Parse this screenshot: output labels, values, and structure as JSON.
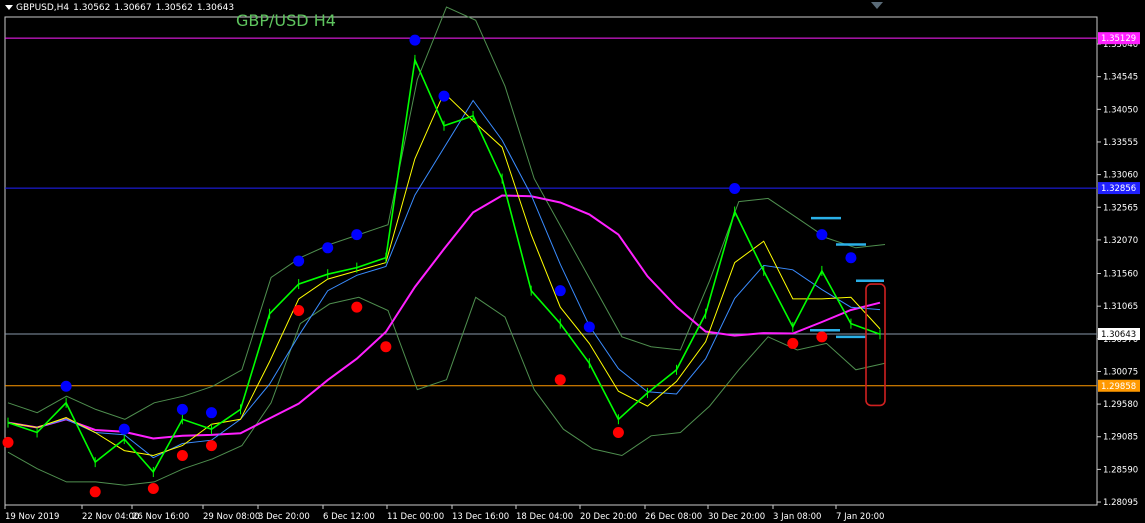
{
  "header": {
    "symbol": "GBPUSD,H4",
    "open": "1.30562",
    "high": "1.30667",
    "low": "1.30562",
    "close": "1.30643"
  },
  "title": "GBP/USD H4",
  "colors": {
    "background": "#000000",
    "candle": "#00ff00",
    "bollinger": "#4f8f4f",
    "ma_fast": "#ffff00",
    "ma_mid": "#3a8cff",
    "ma_slow": "#ff20ff",
    "fractal_up": "#0000ff",
    "fractal_down": "#ff0000",
    "marks": "#2ab0e8",
    "box": "#d02020",
    "axis_text": "#ffffff"
  },
  "chart_data": {
    "type": "line",
    "title": "GBP/USD H4",
    "y_range": [
      1.2805,
      1.3545
    ],
    "y_ticks": [
      "1.35040",
      "1.34545",
      "1.34050",
      "1.33555",
      "1.33060",
      "1.32565",
      "1.32070",
      "1.31560",
      "1.31065",
      "1.30570",
      "1.30075",
      "1.29580",
      "1.29085",
      "1.28590",
      "1.28095"
    ],
    "x_ticks": [
      "19 Nov 2019",
      "22 Nov 04:00",
      "26 Nov 16:00",
      "29 Nov 08:00",
      "3 Dec 20:00",
      "6 Dec 12:00",
      "11 Dec 00:00",
      "13 Dec 16:00",
      "18 Dec 04:00",
      "20 Dec 20:00",
      "26 Dec 08:00",
      "30 Dec 20:00",
      "3 Jan 08:00",
      "7 Jan 20:00"
    ],
    "horizontal_levels": [
      {
        "price": 1.35129,
        "label": "1.35129",
        "color": "#ff20ff"
      },
      {
        "price": 1.32856,
        "label": "1.32856",
        "color": "#2020ff"
      },
      {
        "price": 1.30643,
        "label": "1.30643",
        "color": "#8899aa"
      },
      {
        "price": 1.29858,
        "label": "1.29858",
        "color": "#ff9900"
      }
    ],
    "price_path": [
      {
        "x": "19 Nov 2019",
        "y": 1.293
      },
      {
        "x": "20 Nov",
        "y": 1.2915
      },
      {
        "x": "21 Nov",
        "y": 1.296
      },
      {
        "x": "22 Nov 04:00",
        "y": 1.287
      },
      {
        "x": "25 Nov",
        "y": 1.2905
      },
      {
        "x": "26 Nov 16:00",
        "y": 1.2855
      },
      {
        "x": "27 Nov",
        "y": 1.2935
      },
      {
        "x": "29 Nov 08:00",
        "y": 1.292
      },
      {
        "x": "2 Dec",
        "y": 1.295
      },
      {
        "x": "3 Dec 20:00",
        "y": 1.3095
      },
      {
        "x": "5 Dec",
        "y": 1.314
      },
      {
        "x": "6 Dec 12:00",
        "y": 1.3155
      },
      {
        "x": "9 Dec",
        "y": 1.3165
      },
      {
        "x": "10 Dec",
        "y": 1.318
      },
      {
        "x": "11 Dec 00:00",
        "y": 1.348
      },
      {
        "x": "12 Dec",
        "y": 1.338
      },
      {
        "x": "13 Dec 16:00",
        "y": 1.3395
      },
      {
        "x": "16 Dec",
        "y": 1.33
      },
      {
        "x": "17 Dec",
        "y": 1.313
      },
      {
        "x": "18 Dec 04:00",
        "y": 1.308
      },
      {
        "x": "19 Dec",
        "y": 1.302
      },
      {
        "x": "20 Dec 20:00",
        "y": 1.2935
      },
      {
        "x": "23 Dec",
        "y": 1.2975
      },
      {
        "x": "26 Dec 08:00",
        "y": 1.301
      },
      {
        "x": "27 Dec",
        "y": 1.3095
      },
      {
        "x": "30 Dec 20:00",
        "y": 1.325
      },
      {
        "x": "1 Jan",
        "y": 1.316
      },
      {
        "x": "3 Jan 08:00",
        "y": 1.3075
      },
      {
        "x": "6 Jan",
        "y": 1.316
      },
      {
        "x": "7 Jan 20:00",
        "y": 1.308
      },
      {
        "x": "8 Jan",
        "y": 1.3064
      }
    ],
    "series": [
      {
        "name": "Bollinger upper",
        "values": [
          1.296,
          1.2945,
          1.297,
          1.295,
          1.2935,
          1.296,
          1.297,
          1.2985,
          1.301,
          1.315,
          1.318,
          1.32,
          1.3215,
          1.323,
          1.345,
          1.356,
          1.354,
          1.344,
          1.33,
          1.322,
          1.314,
          1.306,
          1.3045,
          1.304,
          1.3145,
          1.3265,
          1.327,
          1.324,
          1.321,
          1.3195,
          1.32
        ]
      },
      {
        "name": "Bollinger lower",
        "values": [
          1.2885,
          1.286,
          1.284,
          1.284,
          1.2835,
          1.284,
          1.286,
          1.2875,
          1.2895,
          1.296,
          1.308,
          1.311,
          1.312,
          1.31,
          1.298,
          1.2995,
          1.312,
          1.309,
          1.298,
          1.292,
          1.289,
          1.288,
          1.291,
          1.2915,
          1.2955,
          1.301,
          1.306,
          1.304,
          1.305,
          1.301,
          1.302
        ]
      }
    ],
    "fractals_up": [
      {
        "x": "21 Nov",
        "y": 1.2985
      },
      {
        "x": "25 Nov",
        "y": 1.292
      },
      {
        "x": "27 Nov",
        "y": 1.295
      },
      {
        "x": "29 Nov 08:00",
        "y": 1.2945
      },
      {
        "x": "5 Dec",
        "y": 1.3175
      },
      {
        "x": "6 Dec 12:00",
        "y": 1.3195
      },
      {
        "x": "9 Dec",
        "y": 1.3215
      },
      {
        "x": "11 Dec 00:00",
        "y": 1.351
      },
      {
        "x": "12 Dec",
        "y": 1.3425
      },
      {
        "x": "18 Dec 04:00",
        "y": 1.313
      },
      {
        "x": "19 Dec",
        "y": 1.3075
      },
      {
        "x": "30 Dec 20:00",
        "y": 1.3285
      },
      {
        "x": "6 Jan",
        "y": 1.3215
      },
      {
        "x": "7 Jan 20:00",
        "y": 1.318
      }
    ],
    "fractals_down": [
      {
        "x": "19 Nov 2019",
        "y": 1.29
      },
      {
        "x": "22 Nov 04:00",
        "y": 1.2825
      },
      {
        "x": "26 Nov 16:00",
        "y": 1.283
      },
      {
        "x": "27 Nov",
        "y": 1.288
      },
      {
        "x": "29 Nov 08:00",
        "y": 1.2895
      },
      {
        "x": "5 Dec",
        "y": 1.31
      },
      {
        "x": "9 Dec",
        "y": 1.3105
      },
      {
        "x": "10 Dec",
        "y": 1.3045
      },
      {
        "x": "18 Dec 04:00",
        "y": 1.2995
      },
      {
        "x": "20 Dec 20:00",
        "y": 1.2915
      },
      {
        "x": "3 Jan 08:00",
        "y": 1.305
      },
      {
        "x": "6 Jan",
        "y": 1.306
      }
    ]
  }
}
